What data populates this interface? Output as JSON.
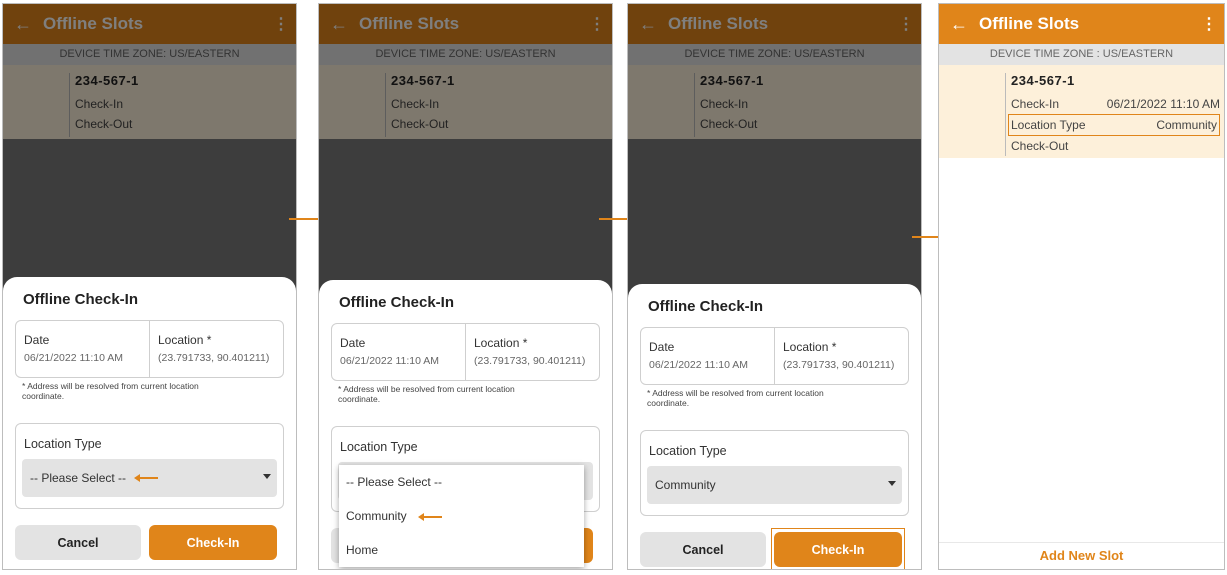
{
  "app": {
    "title": "Offline Slots",
    "back_icon": "←",
    "more_icon": "⋮",
    "accent": "#e0851a"
  },
  "timezone": {
    "screens123": "DEVICE TIME ZONE: US/EASTERN",
    "screen4": "DEVICE TIME ZONE : US/EASTERN"
  },
  "slot": {
    "id": "234-567-1",
    "check_in": "Check-In",
    "check_out": "Check-Out",
    "check_in_time": "06/21/2022 11:10 AM",
    "location_type_label": "Location Type",
    "location_type_value": "Community"
  },
  "sheet": {
    "title": "Offline Check-In",
    "date_label": "Date",
    "date_value": "06/21/2022 11:10 AM",
    "location_label": "Location *",
    "location_value": "(23.791733, 90.401211)",
    "note": "* Address will be resolved from current location coordinate.",
    "location_type_label": "Location Type",
    "select_placeholder": "-- Please Select --",
    "select_selected": "Community",
    "cancel": "Cancel",
    "checkin": "Check-In"
  },
  "dropdown": {
    "options": [
      "-- Please Select --",
      "Community",
      "Home"
    ]
  },
  "footer": {
    "add_new_slot": "Add New Slot"
  }
}
